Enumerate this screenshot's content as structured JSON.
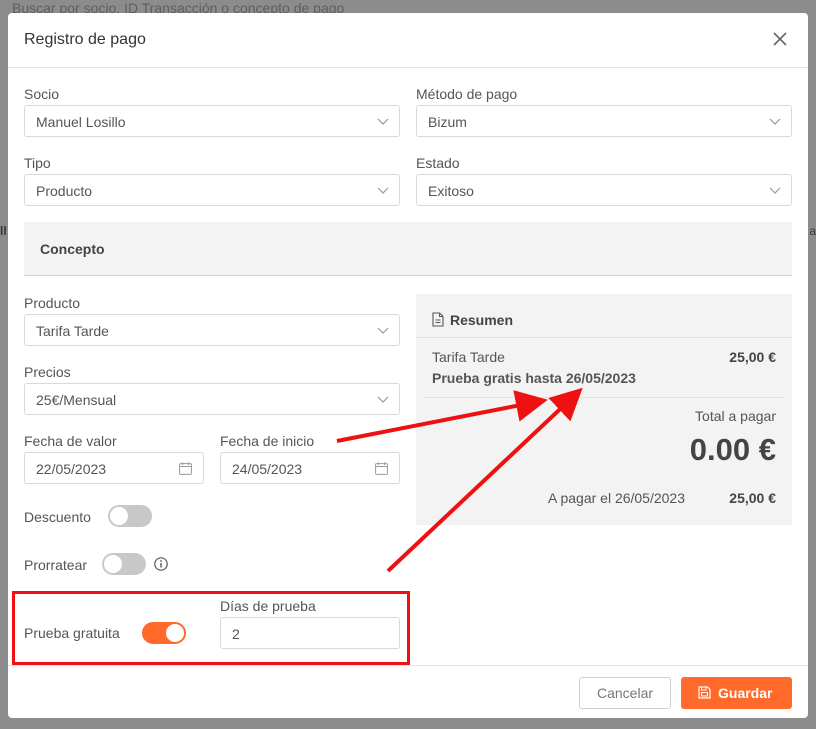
{
  "background": {
    "search_placeholder": "Buscar por socio, ID Transacción o concepto de pago"
  },
  "modal": {
    "title": "Registro de pago",
    "close_icon": "close-icon"
  },
  "form": {
    "socio_label": "Socio",
    "socio_value": "Manuel Losillo",
    "metodo_label": "Método de pago",
    "metodo_value": "Bizum",
    "tipo_label": "Tipo",
    "tipo_value": "Producto",
    "estado_label": "Estado",
    "estado_value": "Exitoso"
  },
  "concepto": {
    "title": "Concepto",
    "producto_label": "Producto",
    "producto_value": "Tarifa Tarde",
    "precios_label": "Precios",
    "precios_value": "25€/Mensual",
    "fecha_valor_label": "Fecha de valor",
    "fecha_valor_value": "22/05/2023",
    "fecha_inicio_label": "Fecha de inicio",
    "fecha_inicio_value": "24/05/2023",
    "descuento_label": "Descuento",
    "descuento_on": false,
    "prorratear_label": "Prorratear",
    "prorratear_on": false,
    "prueba_label": "Prueba gratuita",
    "prueba_on": true,
    "dias_label": "Días de prueba",
    "dias_value": "2"
  },
  "summary": {
    "title": "Resumen",
    "item_name": "Tarifa Tarde",
    "item_price": "25,00 €",
    "trial_text": "Prueba gratis hasta 26/05/2023",
    "total_label": "Total a pagar",
    "total_value": "0.00 €",
    "pay_on_label": "A pagar el 26/05/2023",
    "pay_on_amount": "25,00 €"
  },
  "footer": {
    "cancel_label": "Cancelar",
    "save_label": "Guardar"
  },
  "colors": {
    "accent": "#ff6a2b",
    "annotation": "#ee1111"
  }
}
